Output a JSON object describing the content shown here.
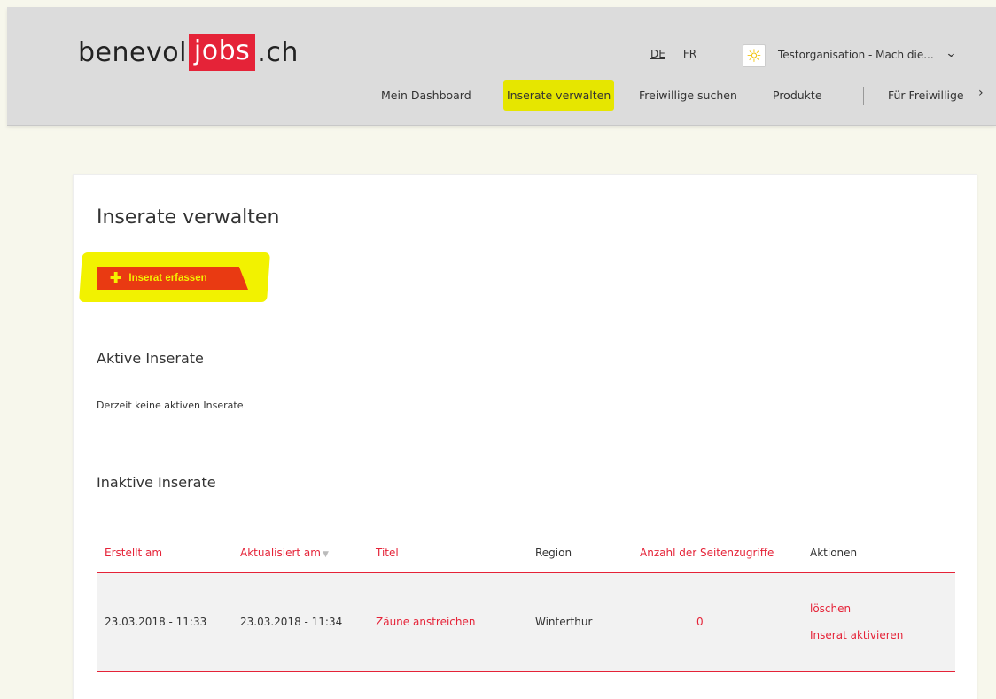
{
  "header": {
    "logo": {
      "left": "benevol",
      "middle": "jobs",
      "right": ".ch"
    },
    "languages": [
      {
        "label": "DE",
        "active": true
      },
      {
        "label": "FR",
        "active": false
      }
    ],
    "org_name": "Testorganisation - Mach die...",
    "nav": [
      {
        "label": "Mein Dashboard",
        "highlighted": false
      },
      {
        "label": "Inserate verwalten",
        "highlighted": true
      },
      {
        "label": "Freiwillige suchen",
        "highlighted": false
      },
      {
        "label": "Produkte",
        "highlighted": false
      },
      {
        "label": "Für Freiwillige",
        "highlighted": false
      }
    ]
  },
  "main": {
    "title": "Inserate verwalten",
    "add_button_label": "Inserat erfassen",
    "active_heading": "Aktive Inserate",
    "active_empty": "Derzeit keine aktiven Inserate",
    "inactive_heading": "Inaktive Inserate",
    "table": {
      "headers": [
        "Erstellt am",
        "Aktualisiert am",
        "Titel",
        "Region",
        "Anzahl der Seitenzugriffe",
        "Aktionen"
      ],
      "rows": [
        {
          "created": "23.03.2018 - 11:33",
          "updated": "23.03.2018 - 11:34",
          "title": "Zäune anstreichen",
          "region": "Winterthur",
          "views": "0",
          "actions": [
            "löschen",
            "Inserat aktivieren"
          ]
        }
      ]
    }
  },
  "colors": {
    "brand_red": "#e52338",
    "highlight_yellow": "#e6e600",
    "button_orange": "#e93a12",
    "header_bg": "#dcdcdc"
  }
}
